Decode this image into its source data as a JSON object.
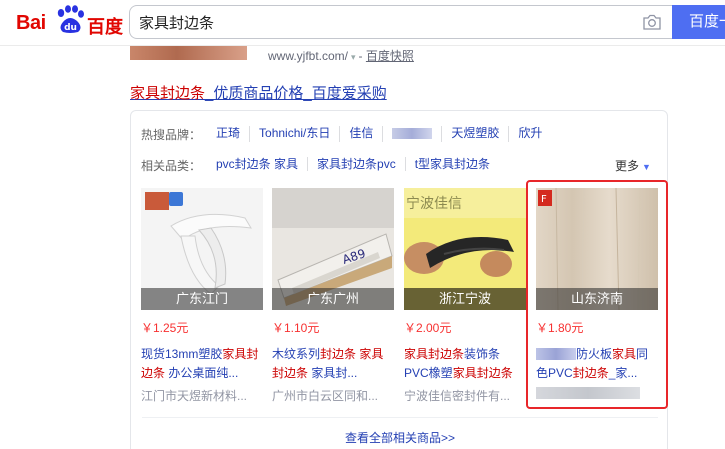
{
  "header": {
    "logo_text_left": "Bai",
    "logo_text_right": "百度",
    "search_value": "家具封边条",
    "search_button": "百度一下"
  },
  "prev_result": {
    "url": "www.yjfbt.com/",
    "snapshot": "百度快照"
  },
  "result": {
    "title_highlight": "家具封边条",
    "title_rest": "_优质商品价格_百度爱采购"
  },
  "brands": {
    "label": "热搜品牌：",
    "items": [
      "正琦",
      "Tohnichi/东日",
      "佳信",
      "",
      "天煜塑胶",
      "欣升"
    ]
  },
  "categories": {
    "label": "相关品类：",
    "items": [
      "pvc封边条 家具",
      "家具封边条pvc",
      "t型家具封边条"
    ],
    "more": "更多"
  },
  "products": [
    {
      "region": "广东江门",
      "price": "￥1.25元",
      "desc_a": "现货13mm塑胶",
      "desc_hl_a": "家具",
      "desc_nl": "",
      "desc_hl_b": "封边条",
      "desc_b": " 办公桌面纯...",
      "shop": "江门市天煜新材料..."
    },
    {
      "region": "广东广州",
      "price": "￥1.10元",
      "desc_a": "木纹系列",
      "desc_hl_a": "封边条 家具",
      "desc_nl": "",
      "desc_hl_b": "封边条",
      "desc_b": " 家具封...",
      "shop": "广州市白云区同和..."
    },
    {
      "region": "浙江宁波",
      "price": "￥2.00元",
      "desc_a": "",
      "desc_hl_a": "家具封边条",
      "desc_nl": "",
      "desc_hl_b": "",
      "desc_b": "装饰条 PVC橡塑",
      "desc_hl_c": "家具封边条",
      "shop": "宁波佳信密封件有..."
    },
    {
      "region": "山东济南",
      "price": "￥1.80元",
      "desc_a": "防火板",
      "desc_hl_a": "家具",
      "desc_b": "同色PVC",
      "desc_hl_b": "封边条",
      "desc_c": "_家...",
      "shop": ""
    }
  ],
  "view_all": "查看全部相关商品>>",
  "image_labels": {
    "p1_watermark": "",
    "p3_overlay": "宁波佳信",
    "p2_label": "A89"
  }
}
